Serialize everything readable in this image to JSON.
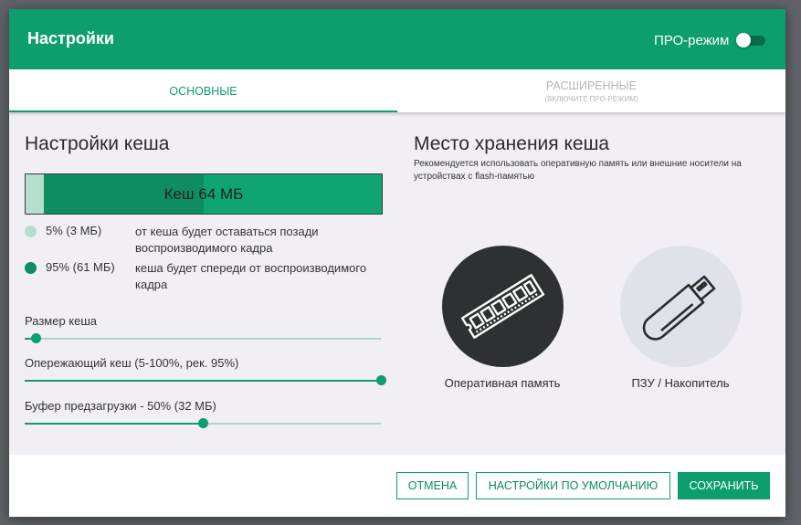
{
  "header": {
    "title": "Настройки",
    "pro_label": "ПРО-режим",
    "pro_enabled": false
  },
  "tabs": {
    "basic": "ОСНОВНЫЕ",
    "advanced": "РАСШИРЕННЫЕ",
    "advanced_hint": "(ВКЛЮЧИТЕ ПРО-РЕЖИМ)"
  },
  "cache": {
    "title": "Настройки кеша",
    "bar_label": "Кеш 64 МБ",
    "behind_fraction": 0.05,
    "ahead_fraction": 0.95,
    "legend": [
      {
        "value": "5% (3 МБ)",
        "desc": "от кеша будет оставаться позади воспроизводимого кадра",
        "color": "#b4dfcf"
      },
      {
        "value": "95% (61 МБ)",
        "desc": "кеша будет спереди от воспроизводимого кадра",
        "color": "#0e8c62"
      }
    ],
    "sliders": [
      {
        "label": "Размер кеша",
        "fraction": 0.03
      },
      {
        "label": "Опережающий кеш (5-100%, рек. 95%)",
        "fraction": 1.0
      },
      {
        "label": "Буфер предзагрузки - 50% (32 МБ)",
        "fraction": 0.5
      }
    ]
  },
  "storage": {
    "title": "Место хранения кеша",
    "subtitle": "Рекомендуется использовать оперативную память или внешние носители на устройствах с flash-памятью",
    "options": [
      {
        "label": "Оперативная память",
        "icon": "ram-icon",
        "selected": true
      },
      {
        "label": "ПЗУ / Накопитель",
        "icon": "usb-drive-icon",
        "selected": false
      }
    ]
  },
  "footer": {
    "cancel": "ОТМЕНА",
    "defaults": "НАСТРОЙКИ ПО УМОЛЧАНИЮ",
    "save": "СОХРАНИТЬ"
  },
  "colors": {
    "accent": "#0d9e6e",
    "selected_circle": "#2e3131",
    "unselected_circle": "#dfe2e7"
  }
}
